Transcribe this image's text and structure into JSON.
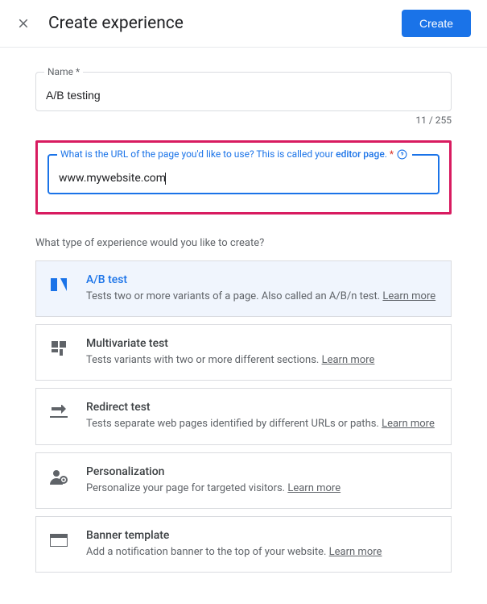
{
  "header": {
    "title": "Create experience",
    "create_btn": "Create"
  },
  "name_field": {
    "label": "Name *",
    "value": "A/B testing",
    "count": "11 / 255"
  },
  "url_field": {
    "label_part1": "What is the URL of the page you'd like to use? This is called your ",
    "label_bold": "editor page",
    "label_part2": ". ",
    "value": "www.mywebsite.com"
  },
  "section_question": "What type of experience would you like to create?",
  "options": {
    "abtest": {
      "title": "A/B test",
      "desc": "Tests two or more variants of a page. Also called an A/B/n test. ",
      "learn": "Learn more"
    },
    "multivariate": {
      "title": "Multivariate test",
      "desc": "Tests variants with two or more different sections. ",
      "learn": "Learn more"
    },
    "redirect": {
      "title": "Redirect test",
      "desc": "Tests separate web pages identified by different URLs or paths. ",
      "learn": "Learn more"
    },
    "personalization": {
      "title": "Personalization",
      "desc": "Personalize your page for targeted visitors. ",
      "learn": "Learn more"
    },
    "banner": {
      "title": "Banner template",
      "desc": "Add a notification banner to the top of your website. ",
      "learn": "Learn more"
    }
  }
}
